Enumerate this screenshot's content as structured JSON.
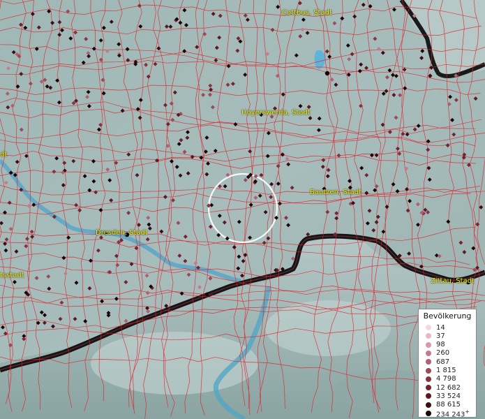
{
  "map": {
    "cities": [
      {
        "id": "cottbus",
        "label": "Cottbus, Stadt"
      },
      {
        "id": "hoyerswerda",
        "label": "Hoyerswerda, Stadt"
      },
      {
        "id": "bautzen",
        "label": "Bautzen, Stadt"
      },
      {
        "id": "dresden",
        "label": "Dresden, Stadt"
      },
      {
        "id": "zittau",
        "label": "Zittau, Stadt"
      },
      {
        "id": "edge-left",
        "label": "tsstadt"
      },
      {
        "id": "edge-left-top",
        "label": "dt"
      }
    ]
  },
  "legend": {
    "title": "Bevölkerung",
    "items": [
      {
        "label": "14",
        "color": "#f4d8e0"
      },
      {
        "label": "37",
        "color": "#e8b8c4"
      },
      {
        "label": "98",
        "color": "#d89aa8"
      },
      {
        "label": "260",
        "color": "#c47c8c"
      },
      {
        "label": "687",
        "color": "#b06070"
      },
      {
        "label": "1 815",
        "color": "#9c4a58"
      },
      {
        "label": "4 798",
        "color": "#883440"
      },
      {
        "label": "12 682",
        "color": "#742430"
      },
      {
        "label": "33 524",
        "color": "#5c1822"
      },
      {
        "label": "88 615",
        "color": "#3c0c14"
      },
      {
        "label": "234 243",
        "color": "#1a0408",
        "plus": "+"
      }
    ]
  }
}
